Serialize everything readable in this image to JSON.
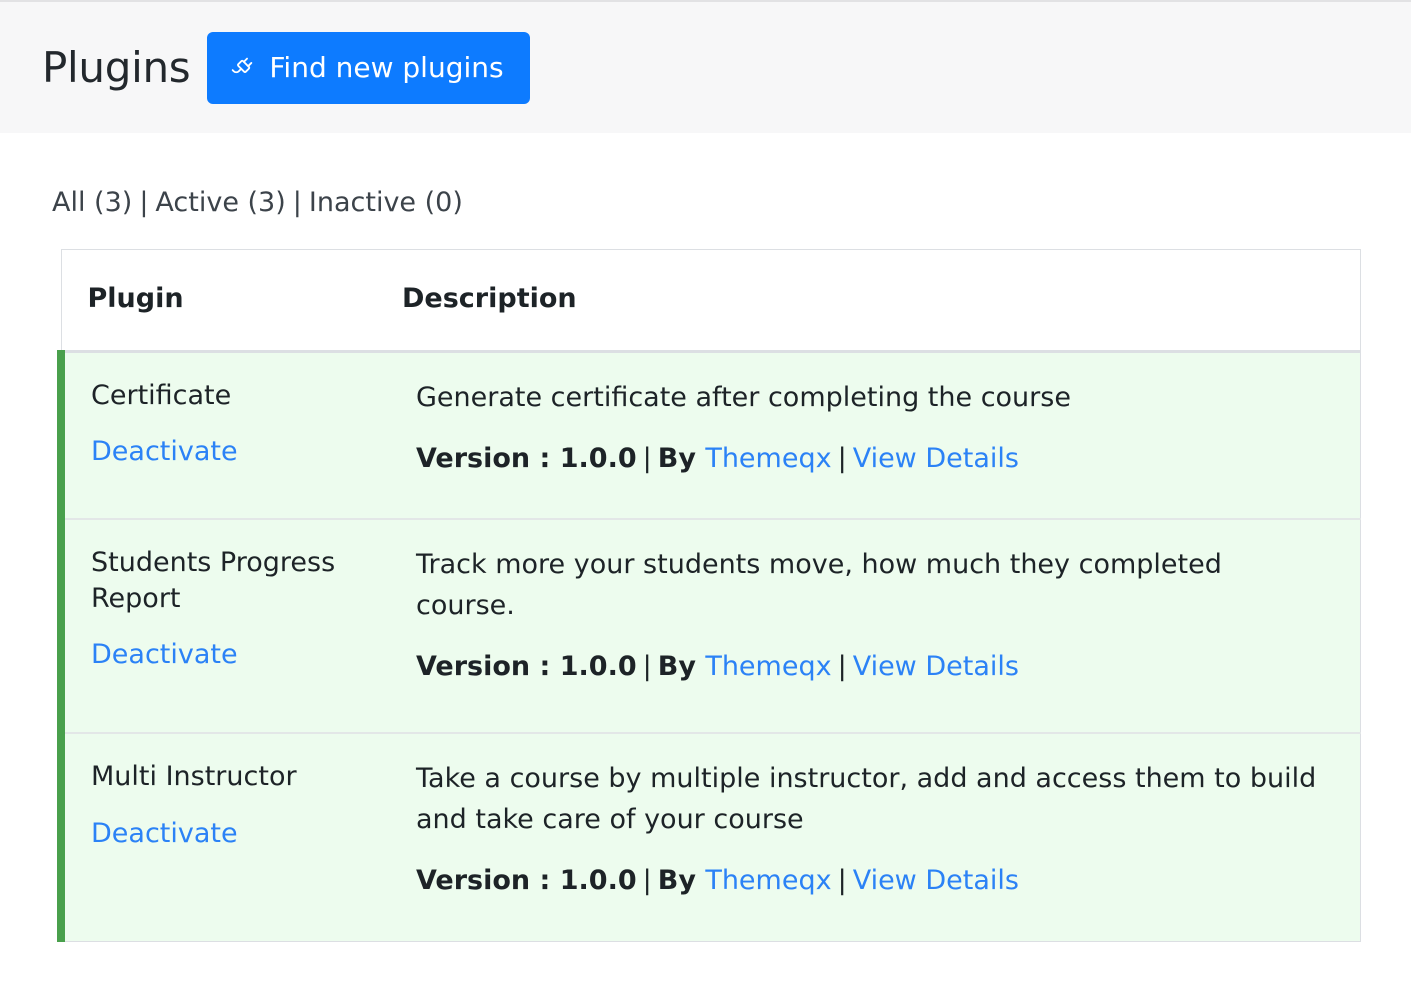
{
  "header": {
    "title": "Plugins",
    "find_button_label": "Find new plugins",
    "find_button_icon": "plug-icon",
    "accent_color": "#0d7bff"
  },
  "filters": {
    "all": "All (3)",
    "separator": "|",
    "active": "Active (3)",
    "inactive": "Inactive (0)"
  },
  "table": {
    "columns": {
      "plugin": "Plugin",
      "description": "Description"
    },
    "active_border_color": "#49a04c",
    "active_row_bg": "#edfcee",
    "rows": [
      {
        "name": "Certificate",
        "action_label": "Deactivate",
        "description": "Generate certificate after completing the course",
        "version_label": "Version : 1.0.0",
        "by_label": "By",
        "author": "Themeqx",
        "details_label": "View Details",
        "separator": "|"
      },
      {
        "name": "Students Progress Report",
        "action_label": "Deactivate",
        "description": "Track more your students move, how much they completed course.",
        "version_label": "Version : 1.0.0",
        "by_label": "By",
        "author": "Themeqx",
        "details_label": "View Details",
        "separator": "|"
      },
      {
        "name": "Multi Instructor",
        "action_label": "Deactivate",
        "description": "Take a course by multiple instructor, add and access them to build and take care of your course",
        "version_label": "Version : 1.0.0",
        "by_label": "By",
        "author": "Themeqx",
        "details_label": "View Details",
        "separator": "|"
      }
    ]
  }
}
